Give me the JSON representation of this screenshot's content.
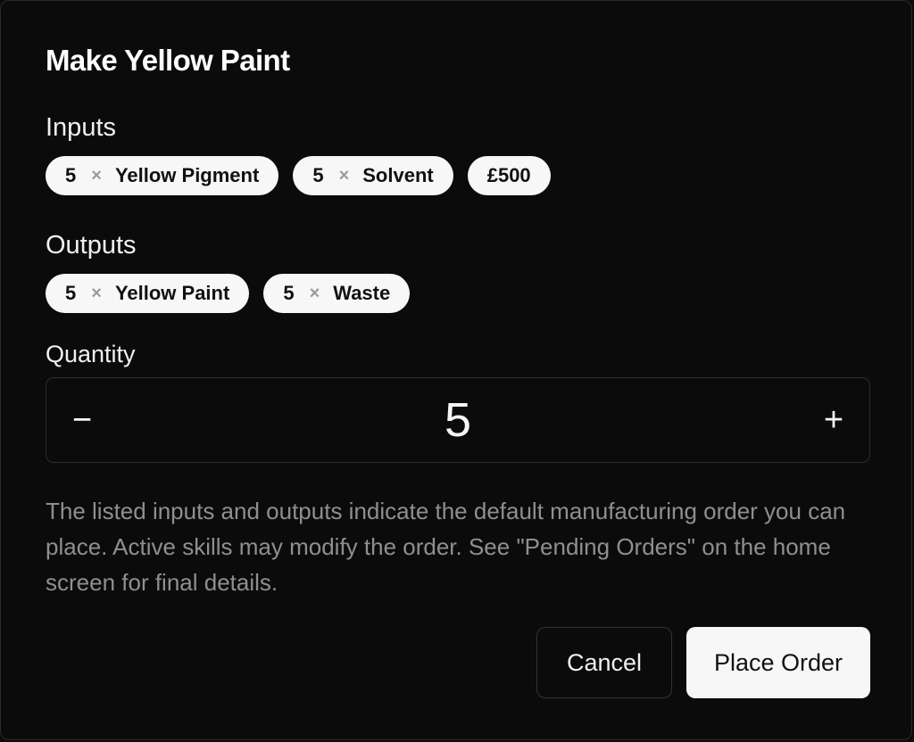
{
  "dialog": {
    "title": "Make Yellow Paint",
    "inputs_label": "Inputs",
    "inputs": [
      {
        "qty": "5",
        "times": "×",
        "name": "Yellow Pigment"
      },
      {
        "qty": "5",
        "times": "×",
        "name": "Solvent"
      },
      {
        "name": "£500"
      }
    ],
    "outputs_label": "Outputs",
    "outputs": [
      {
        "qty": "5",
        "times": "×",
        "name": "Yellow Paint"
      },
      {
        "qty": "5",
        "times": "×",
        "name": "Waste"
      }
    ],
    "quantity_label": "Quantity",
    "quantity": {
      "decrement": "−",
      "value": "5",
      "increment": "+"
    },
    "note": "The listed inputs and outputs indicate the default manufacturing order you can place. Active skills may modify the order. See \"Pending Orders\" on the home screen for final details.",
    "cancel_label": "Cancel",
    "place_order_label": "Place Order"
  }
}
